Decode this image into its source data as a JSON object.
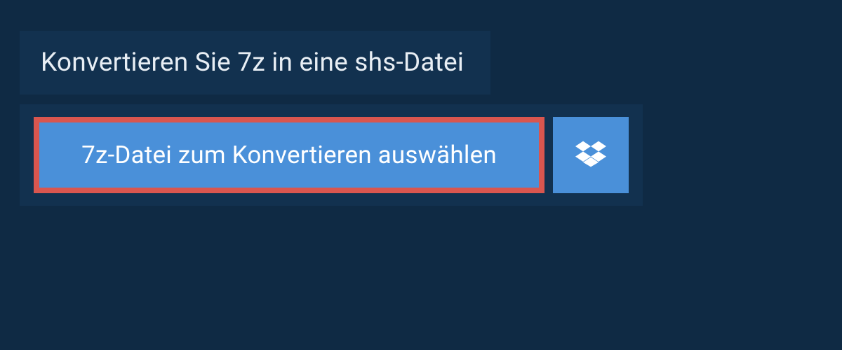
{
  "header": {
    "title": "Konvertieren Sie 7z in eine shs-Datei"
  },
  "upload": {
    "select_file_label": "7z-Datei zum Konvertieren auswählen"
  }
}
